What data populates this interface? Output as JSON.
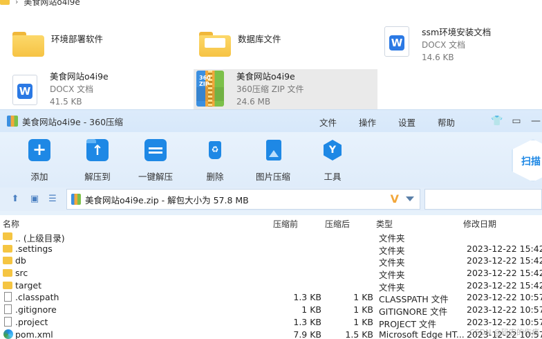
{
  "explorer": {
    "breadcrumb": "美食网站o4i9e",
    "tiles": [
      {
        "name": "环境部署软件",
        "type": "",
        "size": ""
      },
      {
        "name": "数据库文件",
        "type": "",
        "size": ""
      },
      {
        "name": "ssm环境安装文档",
        "type": "DOCX 文档",
        "size": "14.6 KB"
      },
      {
        "name": "美食网站o4i9e",
        "type": "DOCX 文档",
        "size": "41.5 KB"
      },
      {
        "name": "美食网站o4i9e",
        "type": "360压缩 ZIP 文件",
        "size": "24.6 MB"
      }
    ]
  },
  "zipwin": {
    "title": "美食网站o4i9e - 360压缩",
    "menu": [
      "文件",
      "操作",
      "设置",
      "帮助"
    ],
    "toolbar": [
      "添加",
      "解压到",
      "一键解压",
      "删除",
      "图片压缩",
      "工具"
    ],
    "scan_label": "扫描",
    "address": "美食网站o4i9e.zip - 解包大小为 57.8 MB",
    "columns": {
      "name": "名称",
      "before": "压缩前",
      "after": "压缩后",
      "type": "类型",
      "date": "修改日期"
    },
    "rows": [
      {
        "name": ".. (上级目录)",
        "before": "",
        "after": "",
        "type": "文件夹",
        "date": "",
        "icon": "folder"
      },
      {
        "name": ".settings",
        "before": "",
        "after": "",
        "type": "文件夹",
        "date": "2023-12-22 15:42",
        "icon": "folder"
      },
      {
        "name": "db",
        "before": "",
        "after": "",
        "type": "文件夹",
        "date": "2023-12-22 15:42",
        "icon": "folder"
      },
      {
        "name": "src",
        "before": "",
        "after": "",
        "type": "文件夹",
        "date": "2023-12-22 15:42",
        "icon": "folder"
      },
      {
        "name": "target",
        "before": "",
        "after": "",
        "type": "文件夹",
        "date": "2023-12-22 15:42",
        "icon": "folder"
      },
      {
        "name": ".classpath",
        "before": "1.3 KB",
        "after": "1 KB",
        "type": "CLASSPATH 文件",
        "date": "2023-12-22 10:57",
        "icon": "file"
      },
      {
        "name": ".gitignore",
        "before": "1 KB",
        "after": "1 KB",
        "type": "GITIGNORE 文件",
        "date": "2023-12-22 10:57",
        "icon": "file"
      },
      {
        "name": ".project",
        "before": "1.3 KB",
        "after": "1 KB",
        "type": "PROJECT 文件",
        "date": "2023-12-22 10:57",
        "icon": "file"
      },
      {
        "name": "pom.xml",
        "before": "7.9 KB",
        "after": "1.5 KB",
        "type": "Microsoft Edge HT...",
        "date": "2023-12-22 10:57",
        "icon": "edge"
      }
    ],
    "watermark": "CSDN @码农的伤痛"
  }
}
